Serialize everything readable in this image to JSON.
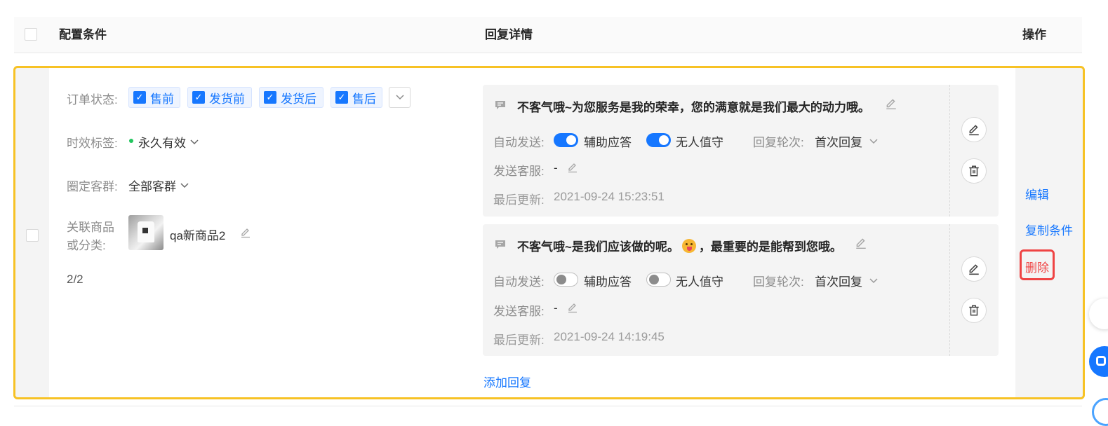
{
  "header": {
    "col_config": "配置条件",
    "col_reply": "回复详情",
    "col_ops": "操作"
  },
  "row": {
    "order_status": {
      "label": "订单状态:",
      "tags": [
        "售前",
        "发货前",
        "发货后",
        "售后"
      ]
    },
    "validity": {
      "label": "时效标签:",
      "value": "永久有效",
      "dot_color": "#22c55e"
    },
    "audience": {
      "label": "圈定客群:",
      "value": "全部客群"
    },
    "product": {
      "label_line1": "关联商品",
      "label_line2": "或分类:",
      "name": "qa新商品2"
    },
    "pager": "2/2",
    "replies": [
      {
        "text": "不客气哦~为您服务是我的荣幸，您的满意就是我们最大的动力哦。",
        "auto_send_label": "自动发送:",
        "assist_label": "辅助应答",
        "assist_on": true,
        "unattended_label": "无人值守",
        "unattended_on": true,
        "round_label": "回复轮次:",
        "round_value": "首次回复",
        "agent_label": "发送客服:",
        "agent_value": "-",
        "updated_label": "最后更新:",
        "updated_value": "2021-09-24 15:23:51"
      },
      {
        "text_a": "不客气哦~是我们应该做的呢。",
        "emoji": "tongue-emoji",
        "text_b": "，最重要的是能帮到您哦。",
        "auto_send_label": "自动发送:",
        "assist_label": "辅助应答",
        "assist_on": false,
        "unattended_label": "无人值守",
        "unattended_on": false,
        "round_label": "回复轮次:",
        "round_value": "首次回复",
        "agent_label": "发送客服:",
        "agent_value": "-",
        "updated_label": "最后更新:",
        "updated_value": "2021-09-24 14:19:45"
      }
    ],
    "add_reply": "添加回复",
    "actions": {
      "edit": "编辑",
      "copy": "复制条件",
      "delete": "删除"
    }
  },
  "colors": {
    "primary": "#1677ff",
    "highlight_outline": "#f7c225",
    "danger": "#ef4444"
  }
}
